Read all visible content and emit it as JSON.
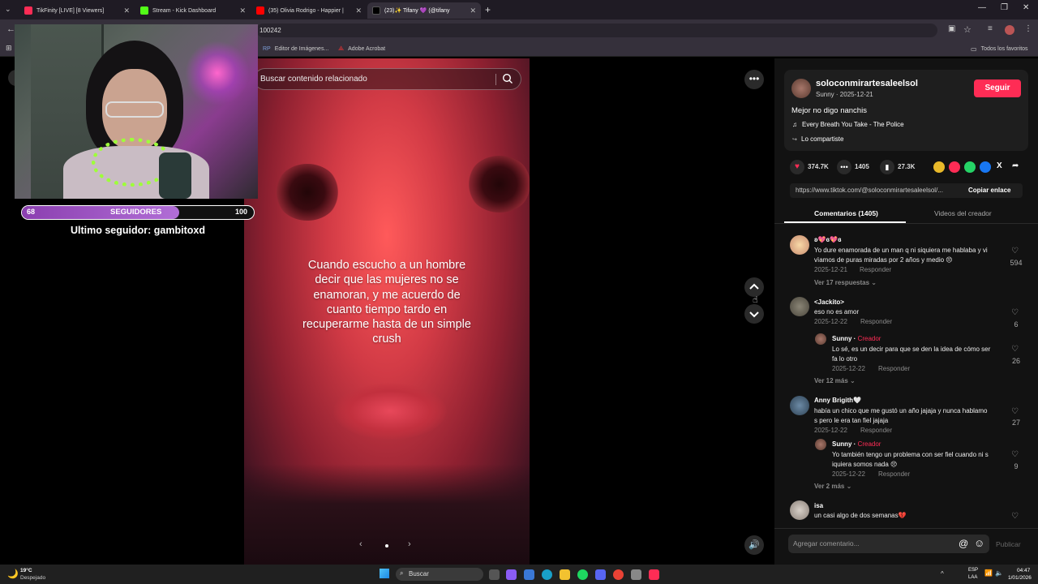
{
  "browser": {
    "tabs": [
      {
        "title": "TikFinity [LIVE] [8 Viewers]",
        "color": "#fe2c55"
      },
      {
        "title": "Stream - Kick Dashboard",
        "color": "#53fc18"
      },
      {
        "title": "(35) Olivia Rodrigo - Happier |",
        "color": "#ff0000"
      },
      {
        "title": "(23)✨ Tifany 💜 (@tifany",
        "color": "#000000"
      }
    ],
    "url": "100242",
    "bookmarks": [
      "Editor de Imágenes...",
      "Adobe Acrobat"
    ],
    "all_bookmarks": "Todos los favoritos"
  },
  "overlay": {
    "followers_current": "68",
    "followers_label": "SEGUIDORES",
    "followers_goal": "100",
    "progress": 0.68,
    "last_follower": "Ultimo seguidor: gambitoxd"
  },
  "video": {
    "search_placeholder": "Buscar contenido relacionado",
    "caption": "Cuando escucho a un hombre decir que las mujeres no se enamoran, y me acuerdo de cuanto tiempo tardo en recuperarme hasta de un simple crush"
  },
  "post": {
    "username": "soloconmirartesaleelsol",
    "subtitle": "Sunny · 2025-12-21",
    "follow_label": "Seguir",
    "description": "Mejor no digo nanchis",
    "music": "Every Breath You Take - The Police",
    "shared": "Lo compartiste",
    "likes": "374.7K",
    "comments": "1405",
    "saves": "27.3K",
    "link": "https://www.tiktok.com/@soloconmirartesaleelsol/...",
    "copy_link": "Copiar enlace",
    "tab_comments": "Comentarios (1405)",
    "tab_videos": "Videos del creador"
  },
  "comments": [
    {
      "name": "ʚ💖ɞ💖ɞ",
      "text1": "Yo dure enamorada de un man q ni siquiera me hablaba y vi",
      "text2": "vìamos de puras miradas por 2 años y medio 😣",
      "date": "2025-12-21",
      "reply": "Responder",
      "likes": "594",
      "more": "Ver 17 respuestas"
    },
    {
      "name": "<Jackito>",
      "text1": "eso no es amor",
      "date": "2025-12-22",
      "reply": "Responder",
      "likes": "6"
    },
    {
      "name": "Sunny · ",
      "tag": "Creador",
      "text1": "Lo sé, es un decir para que se den la idea de cómo ser",
      "text2": "fa lo otro",
      "date": "2025-12-22",
      "reply": "Responder",
      "likes": "26",
      "more": "Ver 12 más"
    },
    {
      "name": "Anny Brigith🤍",
      "text1": "había un chico que me gustó un año jajaja y nunca hablamo",
      "text2": "s pero le era tan fiel jajaja",
      "date": "2025-12-22",
      "reply": "Responder",
      "likes": "27"
    },
    {
      "name": "Sunny · ",
      "tag": "Creador",
      "text1": "Yo también tengo un problema con ser fiel cuando ni s",
      "text2": "iquiera somos nada 😣",
      "date": "2025-12-22",
      "reply": "Responder",
      "likes": "9",
      "more": "Ver 2 más"
    },
    {
      "name": "isa",
      "text1": "un casi algo de dos semanas💔"
    }
  ],
  "compose": {
    "placeholder": "Agregar comentario...",
    "post_label": "Publicar"
  },
  "taskbar": {
    "temp": "19°C",
    "weather": "Despejado",
    "search": "Buscar",
    "lang1": "ESP",
    "lang2": "LAA",
    "time": "04:47",
    "date": "1/01/2026"
  }
}
